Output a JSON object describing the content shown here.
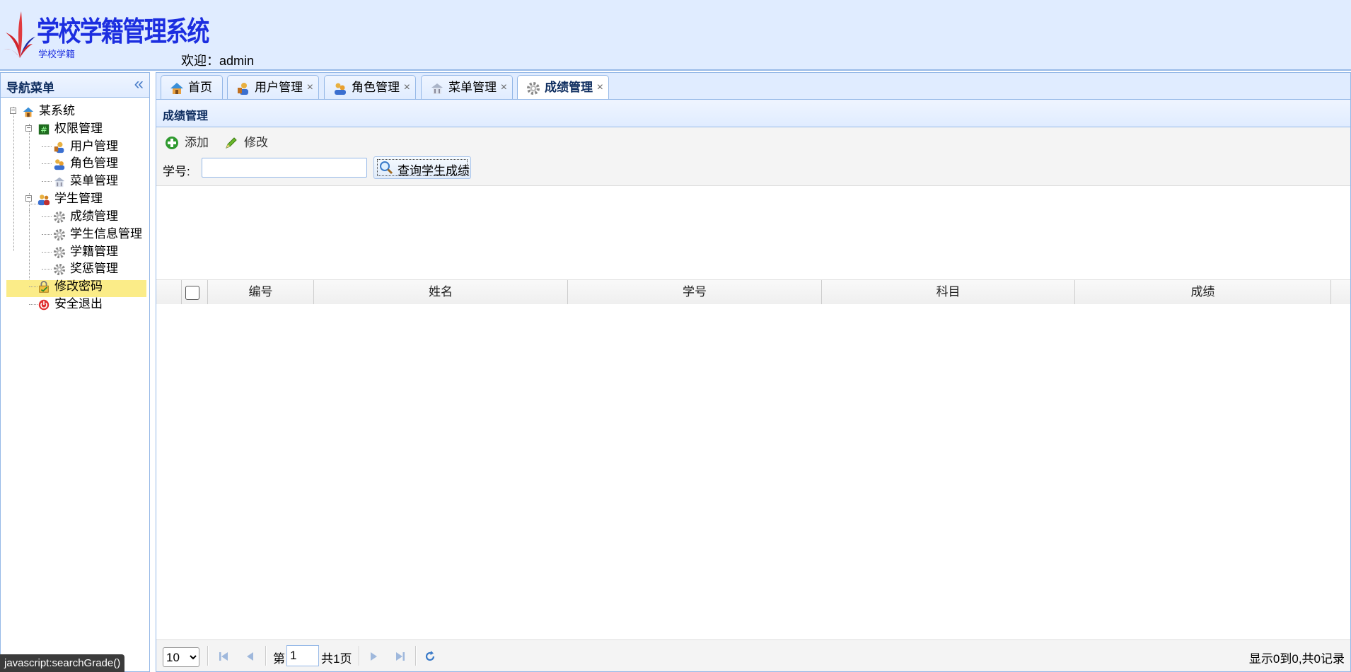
{
  "header": {
    "title": "学校学籍管理系统",
    "subtitle": "学校学籍",
    "welcome": "欢迎：admin"
  },
  "nav": {
    "title": "导航菜单",
    "collapse_icon": "double-chevron-left-icon",
    "tree": [
      {
        "label": "某系统",
        "icon": "home-icon"
      },
      {
        "label": "权限管理",
        "icon": "permission-icon"
      },
      {
        "label": "用户管理",
        "icon": "user-icon"
      },
      {
        "label": "角色管理",
        "icon": "role-icon"
      },
      {
        "label": "菜单管理",
        "icon": "menu-icon"
      },
      {
        "label": "学生管理",
        "icon": "students-icon"
      },
      {
        "label": "成绩管理",
        "icon": "gear-icon",
        "selected": true
      },
      {
        "label": "学生信息管理",
        "icon": "gear-icon"
      },
      {
        "label": "学籍管理",
        "icon": "gear-icon"
      },
      {
        "label": "奖惩管理",
        "icon": "gear-icon"
      },
      {
        "label": "修改密码",
        "icon": "password-icon"
      },
      {
        "label": "安全退出",
        "icon": "exit-icon"
      }
    ]
  },
  "tabs": [
    {
      "label": "首页",
      "icon": "home-icon",
      "closable": false
    },
    {
      "label": "用户管理",
      "icon": "user-icon",
      "closable": true
    },
    {
      "label": "角色管理",
      "icon": "role-icon",
      "closable": true
    },
    {
      "label": "菜单管理",
      "icon": "menu-icon",
      "closable": true
    },
    {
      "label": "成绩管理",
      "icon": "gear-icon",
      "closable": true,
      "active": true
    }
  ],
  "tab_close_glyph": "×",
  "panel": {
    "title": "成绩管理",
    "toolbar": {
      "add_label": "添加",
      "edit_label": "修改"
    },
    "search": {
      "label": "学号:",
      "value": "",
      "button_label": "查询学生成绩"
    },
    "grid": {
      "columns": [
        "编号",
        "姓名",
        "学号",
        "科目",
        "成绩"
      ],
      "rows": []
    },
    "pager": {
      "page_size": "10",
      "page_prefix": "第",
      "page_value": "1",
      "page_total": "共1页",
      "info": "显示0到0,共0记录"
    }
  },
  "statusbar": "javascript:searchGrade()",
  "colors": {
    "header_bg": "#e0ecff",
    "border": "#95b8e7",
    "selected_row": "#fbec88",
    "title_blue": "#1c2ee0"
  }
}
